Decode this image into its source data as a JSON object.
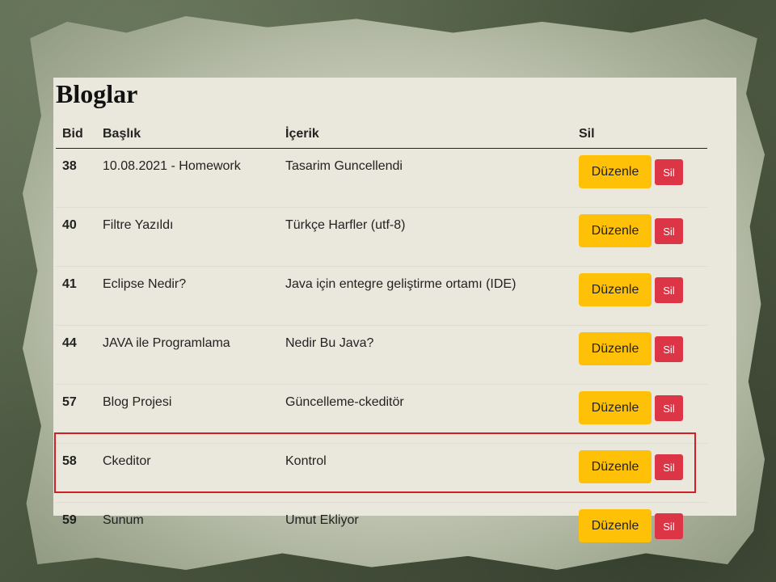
{
  "page": {
    "title": "Bloglar"
  },
  "table": {
    "headers": {
      "bid": "Bid",
      "title": "Başlık",
      "content": "İçerik",
      "delete": "Sil"
    },
    "rows": [
      {
        "bid": "38",
        "title": "10.08.2021 - Homework",
        "content": "Tasarim Guncellendi",
        "edit_label": "Düzenle",
        "delete_label": "Sil"
      },
      {
        "bid": "40",
        "title": "Filtre Yazıldı",
        "content": "Türkçe Harfler (utf-8)",
        "edit_label": "Düzenle",
        "delete_label": "Sil"
      },
      {
        "bid": "41",
        "title": "Eclipse Nedir?",
        "content": "Java için entegre geliştirme ortamı (IDE)",
        "edit_label": "Düzenle",
        "delete_label": "Sil"
      },
      {
        "bid": "44",
        "title": "JAVA ile Programlama",
        "content": "Nedir Bu Java?",
        "edit_label": "Düzenle",
        "delete_label": "Sil"
      },
      {
        "bid": "57",
        "title": "Blog Projesi",
        "content": "Güncelleme-ckeditör",
        "edit_label": "Düzenle",
        "delete_label": "Sil"
      },
      {
        "bid": "58",
        "title": "Ckeditor",
        "content": "Kontrol",
        "edit_label": "Düzenle",
        "delete_label": "Sil"
      },
      {
        "bid": "59",
        "title": "Sunum",
        "content": "Umut Ekliyor",
        "edit_label": "Düzenle",
        "delete_label": "Sil"
      }
    ]
  },
  "colors": {
    "edit_button": "#ffc107",
    "delete_button": "#dc3545",
    "highlight_border": "#d11f26",
    "panel_background": "#eae8dc"
  }
}
